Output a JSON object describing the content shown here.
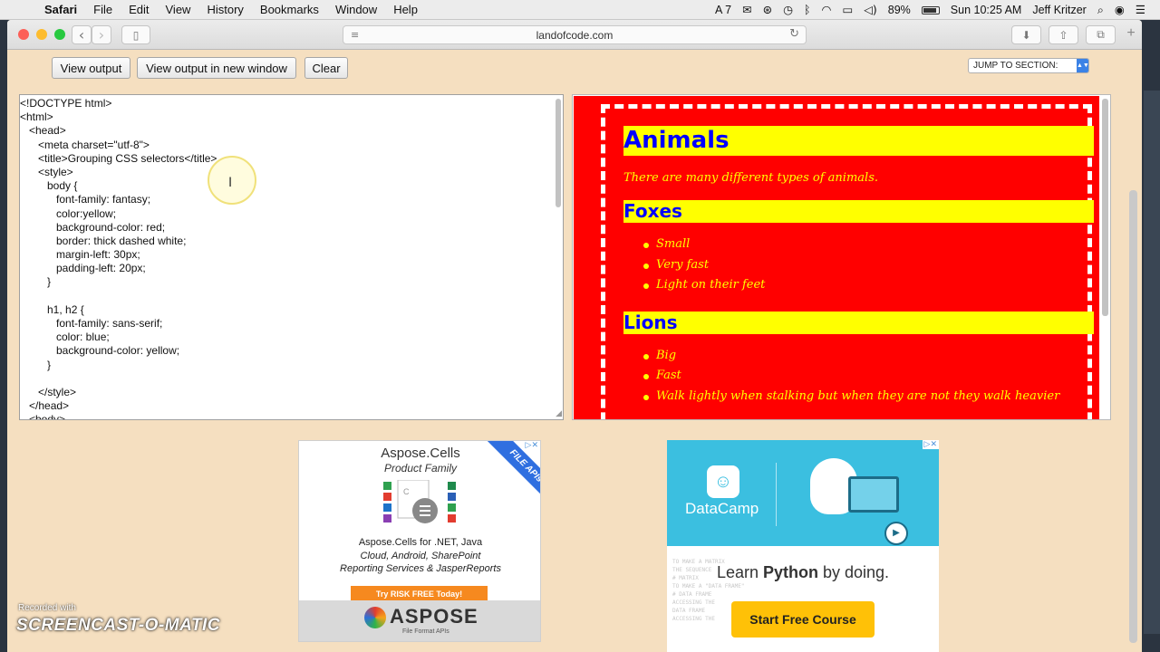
{
  "menubar": {
    "apple": "",
    "app": "Safari",
    "items": [
      "File",
      "Edit",
      "View",
      "History",
      "Bookmarks",
      "Window",
      "Help"
    ],
    "status_a7": "A 7",
    "battery_percent": "89%",
    "clock": "Sun 10:25 AM",
    "user": "Jeff Kritzer"
  },
  "browser": {
    "back": "‹",
    "forward": "›",
    "url": "landofcode.com",
    "new_tab": "+"
  },
  "page": {
    "buttons": {
      "view_output": "View output",
      "view_new_window": "View output in new window",
      "clear": "Clear"
    },
    "jump_select": "JUMP TO SECTION:",
    "code_lines": [
      "<!DOCTYPE html>",
      "<html>",
      "   <head>",
      "      <meta charset=\"utf-8\">",
      "      <title>Grouping CSS selectors</title>",
      "      <style>",
      "         body {",
      "            font-family: fantasy;",
      "            color:yellow;",
      "            background-color: red;",
      "            border: thick dashed white;",
      "            margin-left: 30px;",
      "            padding-left: 20px;",
      "         }",
      "",
      "         h1, h2 {",
      "            font-family: sans-serif;",
      "            color: blue;",
      "            background-color: yellow;",
      "         }",
      "",
      "      </style>",
      "   </head>",
      "   <body>"
    ],
    "preview": {
      "h1": "Animals",
      "p": "There are many different types of animals.",
      "h2_foxes": "Foxes",
      "foxes": [
        "Small",
        "Very fast",
        "Light on their feet"
      ],
      "h2_lions": "Lions",
      "lions": [
        "Big",
        "Fast",
        "Walk lightly when stalking but when they are not they walk heavier"
      ]
    }
  },
  "ads": {
    "aspose": {
      "title": "Aspose.Cells",
      "subtitle": "Product Family",
      "ribbon": "FILE APIs",
      "desc_line1": "Aspose.Cells for .NET, Java",
      "desc_line2": "Cloud, Android, SharePoint",
      "desc_line3": "Reporting Services & JasperReports",
      "cta": "Try RISK FREE Today!",
      "logo": "ASPOSE",
      "tagline": "File Format APIs"
    },
    "datacamp": {
      "brand": "DataCamp",
      "learn_prefix": "Learn ",
      "learn_bold": "Python",
      "learn_suffix": " by doing.",
      "cta": "Start Free Course"
    }
  },
  "watermark": {
    "small": "Recorded with",
    "main": "SCREENCAST-O-MATIC"
  }
}
